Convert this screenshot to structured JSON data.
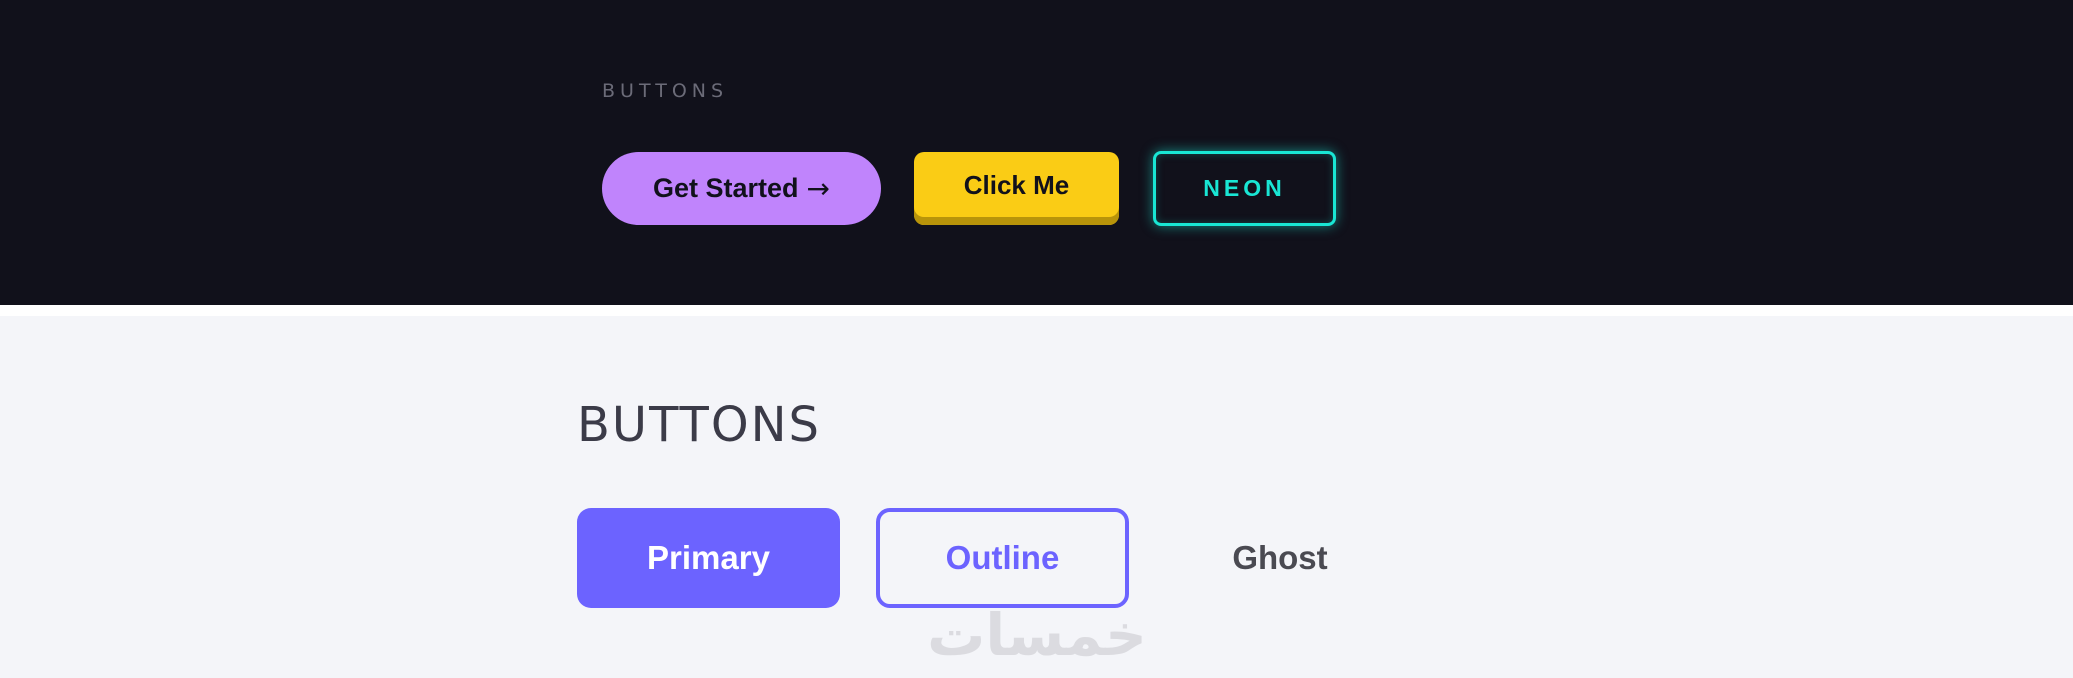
{
  "dark_demo": {
    "section_label": "BUTTONS",
    "buttons": {
      "get_started": {
        "label": "Get Started",
        "arrow": "→"
      },
      "click_me": {
        "label": "Click Me"
      },
      "neon": {
        "label": "NEON"
      }
    }
  },
  "light_demo": {
    "section_title": "BUTTONS",
    "buttons": {
      "primary": {
        "label": "Primary"
      },
      "outline": {
        "label": "Outline"
      },
      "ghost": {
        "label": "Ghost"
      }
    }
  },
  "watermark": {
    "text": "خمسات"
  },
  "colors": {
    "dark_bg": "#11111b",
    "light_bg": "#f4f5f9",
    "pill": "#c084fc",
    "yellow": "#facc15",
    "neon": "#19e6d4",
    "primary": "#6c63ff",
    "ghost_text": "#4a4a52"
  }
}
